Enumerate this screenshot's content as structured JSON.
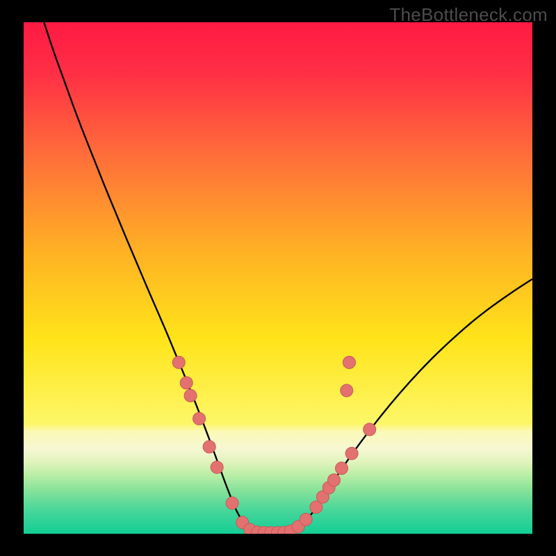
{
  "watermark": "TheBottleneck.com",
  "colors": {
    "bg": "#000000",
    "curve": "#000000",
    "markers_fill": "#e27170",
    "markers_stroke": "#c95a59",
    "gradient_stops": [
      {
        "offset": 0.0,
        "color": "#ff1a44"
      },
      {
        "offset": 0.1,
        "color": "#ff2f45"
      },
      {
        "offset": 0.25,
        "color": "#ff6a3b"
      },
      {
        "offset": 0.45,
        "color": "#ffb224"
      },
      {
        "offset": 0.62,
        "color": "#ffe41a"
      },
      {
        "offset": 0.785,
        "color": "#fdf768"
      },
      {
        "offset": 0.8,
        "color": "#fbf9b6"
      },
      {
        "offset": 0.835,
        "color": "#f6f8d4"
      },
      {
        "offset": 0.86,
        "color": "#e0f3bb"
      },
      {
        "offset": 0.885,
        "color": "#baeea6"
      },
      {
        "offset": 0.915,
        "color": "#86e29a"
      },
      {
        "offset": 0.955,
        "color": "#47d69a"
      },
      {
        "offset": 1.0,
        "color": "#12ce95"
      }
    ]
  },
  "chart_data": {
    "type": "line",
    "title": "",
    "xlabel": "",
    "ylabel": "",
    "xlim": [
      0,
      100
    ],
    "ylim": [
      0,
      100
    ],
    "grid": false,
    "legend": false,
    "series": [
      {
        "name": "bottleneck-curve",
        "x": [
          4,
          6,
          8,
          10,
          12,
          14,
          16,
          18,
          20,
          22,
          24,
          26,
          28,
          30,
          32,
          34,
          36,
          38,
          40,
          42,
          44,
          45,
          46,
          47,
          48,
          49,
          50,
          51,
          52,
          53,
          55,
          57,
          59,
          61,
          64,
          68,
          72,
          76,
          80,
          84,
          88,
          92,
          96,
          100
        ],
        "y": [
          100,
          94,
          88.5,
          83,
          77.8,
          72.8,
          67.8,
          63,
          58.2,
          53.5,
          48.8,
          44.2,
          39.6,
          34.8,
          30,
          25,
          19.8,
          14.4,
          9,
          4.2,
          1.2,
          0.6,
          0.3,
          0.2,
          0.2,
          0.2,
          0.2,
          0.25,
          0.4,
          0.9,
          2.2,
          4.4,
          7.2,
          10.4,
          14.8,
          20.2,
          25.2,
          29.8,
          34.0,
          37.8,
          41.3,
          44.4,
          47.2,
          49.8
        ]
      }
    ],
    "markers": {
      "name": "highlighted-points",
      "points": [
        {
          "x": 30.5,
          "y": 33.5
        },
        {
          "x": 32.0,
          "y": 29.5
        },
        {
          "x": 32.8,
          "y": 27.0
        },
        {
          "x": 34.5,
          "y": 22.5
        },
        {
          "x": 36.5,
          "y": 17.0
        },
        {
          "x": 38.0,
          "y": 13.0
        },
        {
          "x": 41.0,
          "y": 6.0
        },
        {
          "x": 43.0,
          "y": 2.2
        },
        {
          "x": 44.5,
          "y": 0.8
        },
        {
          "x": 46.0,
          "y": 0.3
        },
        {
          "x": 47.3,
          "y": 0.2
        },
        {
          "x": 48.6,
          "y": 0.2
        },
        {
          "x": 49.9,
          "y": 0.2
        },
        {
          "x": 51.2,
          "y": 0.25
        },
        {
          "x": 52.5,
          "y": 0.5
        },
        {
          "x": 54.0,
          "y": 1.4
        },
        {
          "x": 55.5,
          "y": 2.8
        },
        {
          "x": 57.5,
          "y": 5.2
        },
        {
          "x": 58.8,
          "y": 7.2
        },
        {
          "x": 60.0,
          "y": 9.0
        },
        {
          "x": 61.0,
          "y": 10.5
        },
        {
          "x": 62.5,
          "y": 12.8
        },
        {
          "x": 64.5,
          "y": 15.7
        },
        {
          "x": 68.0,
          "y": 20.4
        },
        {
          "x": 63.5,
          "y": 28.0
        },
        {
          "x": 64.0,
          "y": 33.5
        }
      ]
    }
  }
}
